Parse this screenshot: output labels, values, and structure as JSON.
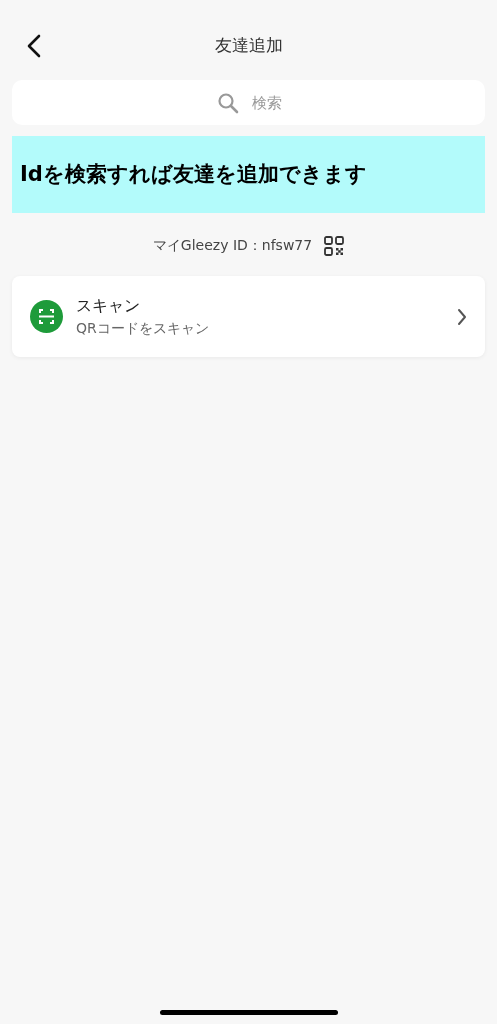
{
  "header": {
    "title": "友達追加"
  },
  "search": {
    "placeholder": "検索"
  },
  "banner": {
    "text": "Idを検索すれば友達を追加できます"
  },
  "my_id": {
    "text": "マイGleezy ID：nfsw77"
  },
  "options": [
    {
      "title": "スキャン",
      "subtitle": "QRコードをスキャン"
    }
  ]
}
